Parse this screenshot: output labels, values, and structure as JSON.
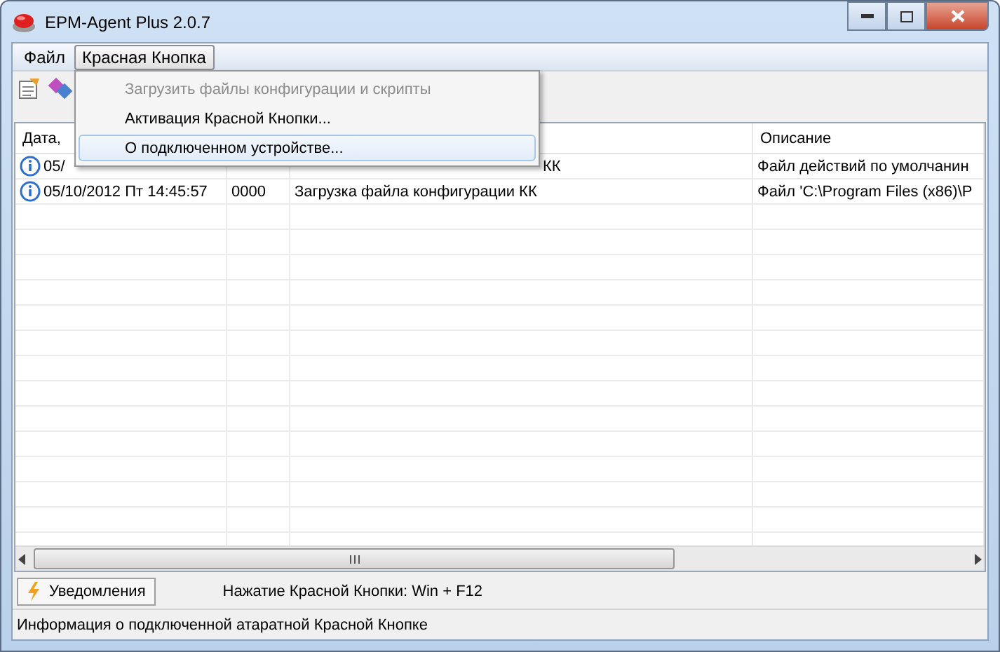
{
  "window": {
    "title": "EPM-Agent Plus 2.0.7"
  },
  "menu": [
    {
      "label": "Файл",
      "selected": false
    },
    {
      "label": "Красная Кнопка",
      "selected": true
    }
  ],
  "dropdown": [
    {
      "label": "Загрузить файлы конфигурации и скрипты",
      "disabled": true,
      "selected": false
    },
    {
      "label": "Активация Красной Кнопки...",
      "disabled": false,
      "selected": false
    },
    {
      "label": "О подключенном устройстве...",
      "disabled": false,
      "selected": true
    }
  ],
  "table": {
    "columns": [
      "Дата,",
      "",
      "",
      "Описание"
    ],
    "rows": [
      {
        "covered": true,
        "cells": [
          "05/",
          "",
          "КК",
          "Файл действий по умолчанин"
        ]
      },
      {
        "covered": false,
        "cells": [
          "05/10/2012 Пт  14:45:57",
          "0000",
          "Загрузка файла конфигурации КК",
          "Файл 'C:\\Program Files (x86)\\P"
        ]
      }
    ]
  },
  "bottom_tab": {
    "label": "Уведомления"
  },
  "hotkey": "Нажатие Красной Кнопки: Win + F12",
  "status_bar": "Информация о подключенной атаратной Красной Кнопке"
}
